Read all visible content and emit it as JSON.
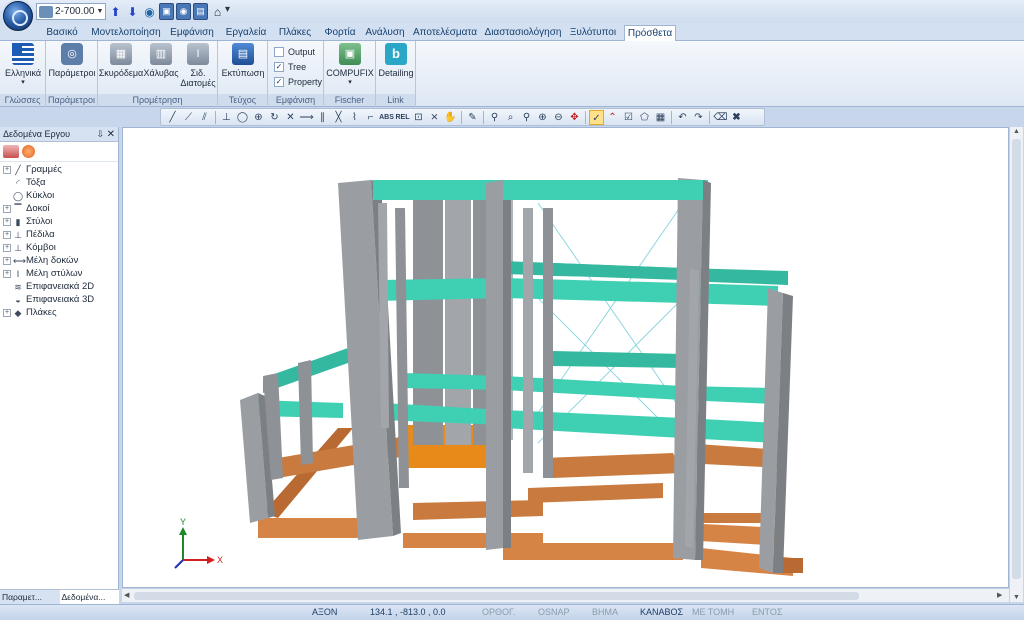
{
  "quick_access": {
    "combo_value": "2-700.00",
    "more_glyph": "▾"
  },
  "tabs": [
    "Βασικό",
    "Μοντελοποίηση",
    "Εμφάνιση",
    "Εργαλεία",
    "Πλάκες",
    "Φορτία",
    "Ανάλυση",
    "Αποτελέσματα",
    "Διαστασιολόγηση",
    "Ξυλότυποι",
    "Πρόσθετα"
  ],
  "active_tab": "Πρόσθετα",
  "ribbon": {
    "language": {
      "button": "Ελληνικά",
      "group": "Γλώσσες"
    },
    "params": {
      "button": "Παράμετροι",
      "group": "Παράμετροι"
    },
    "procurement": {
      "btn1": "Σκυρόδεμα",
      "btn2": "Χάλυβας",
      "btn3_line1": "Σιδ.",
      "btn3_line2": "Διατομές",
      "group": "Προμέτρηση"
    },
    "booklet": {
      "button": "Εκτύπωση",
      "group": "Τεύχος"
    },
    "view": {
      "checks": [
        {
          "label": "Output",
          "checked": false
        },
        {
          "label": "Tree",
          "checked": true
        },
        {
          "label": "Property",
          "checked": true
        }
      ],
      "group": "Εμφάνιση"
    },
    "fischer": {
      "button": "COMPUFIX",
      "group": "Fischer"
    },
    "link": {
      "button": "Detailing",
      "group": "Link"
    }
  },
  "toolbar": {
    "abs_label": "ABS",
    "rel_label": "REL"
  },
  "left_panel": {
    "title": "Δεδομένα Εργου",
    "tree": [
      {
        "label": "Γραμμές",
        "icon": "line-icon",
        "expandable": true
      },
      {
        "label": "Τόξα",
        "icon": "arc-icon",
        "expandable": false
      },
      {
        "label": "Κύκλοι",
        "icon": "circle-icon",
        "expandable": false
      },
      {
        "label": "Δοκοί",
        "icon": "beam-icon",
        "expandable": true
      },
      {
        "label": "Στύλοι",
        "icon": "column-icon",
        "expandable": true
      },
      {
        "label": "Πέδιλα",
        "icon": "footing-icon",
        "expandable": true
      },
      {
        "label": "Κόμβοι",
        "icon": "node-icon",
        "expandable": true
      },
      {
        "label": "Μέλη δοκών",
        "icon": "beam-member-icon",
        "expandable": true
      },
      {
        "label": "Μέλη στύλων",
        "icon": "column-member-icon",
        "expandable": true
      },
      {
        "label": "Επιφανειακά 2D",
        "icon": "surface-2d-icon",
        "expandable": false
      },
      {
        "label": "Επιφανειακά 3D",
        "icon": "surface-3d-icon",
        "expandable": false
      },
      {
        "label": "Πλάκες",
        "icon": "slab-icon",
        "expandable": true
      }
    ],
    "bottom_tabs": [
      "Παραμετ...",
      "Δεδομένα..."
    ]
  },
  "axes": {
    "x_label": "X",
    "y_label": "Y"
  },
  "status": {
    "axis_label": "ΑΞΟΝ",
    "coords": "134.1 , -813.0 , 0.0",
    "ortho": "ΟΡΘΟΓ.",
    "osnap": "OSNAP",
    "step": "ΒΗΜΑ",
    "grid": "ΚΑΝΑΒΟΣ",
    "section": "ΜΕ ΤΟΜΗ",
    "inside": "ΕΝΤΟΣ"
  },
  "colors": {
    "beam_teal": "#3fcfb3",
    "column_gray": "#9a9ea3",
    "footing_orange": "#d68446",
    "ribbon_blue": "#d3e0f1"
  }
}
